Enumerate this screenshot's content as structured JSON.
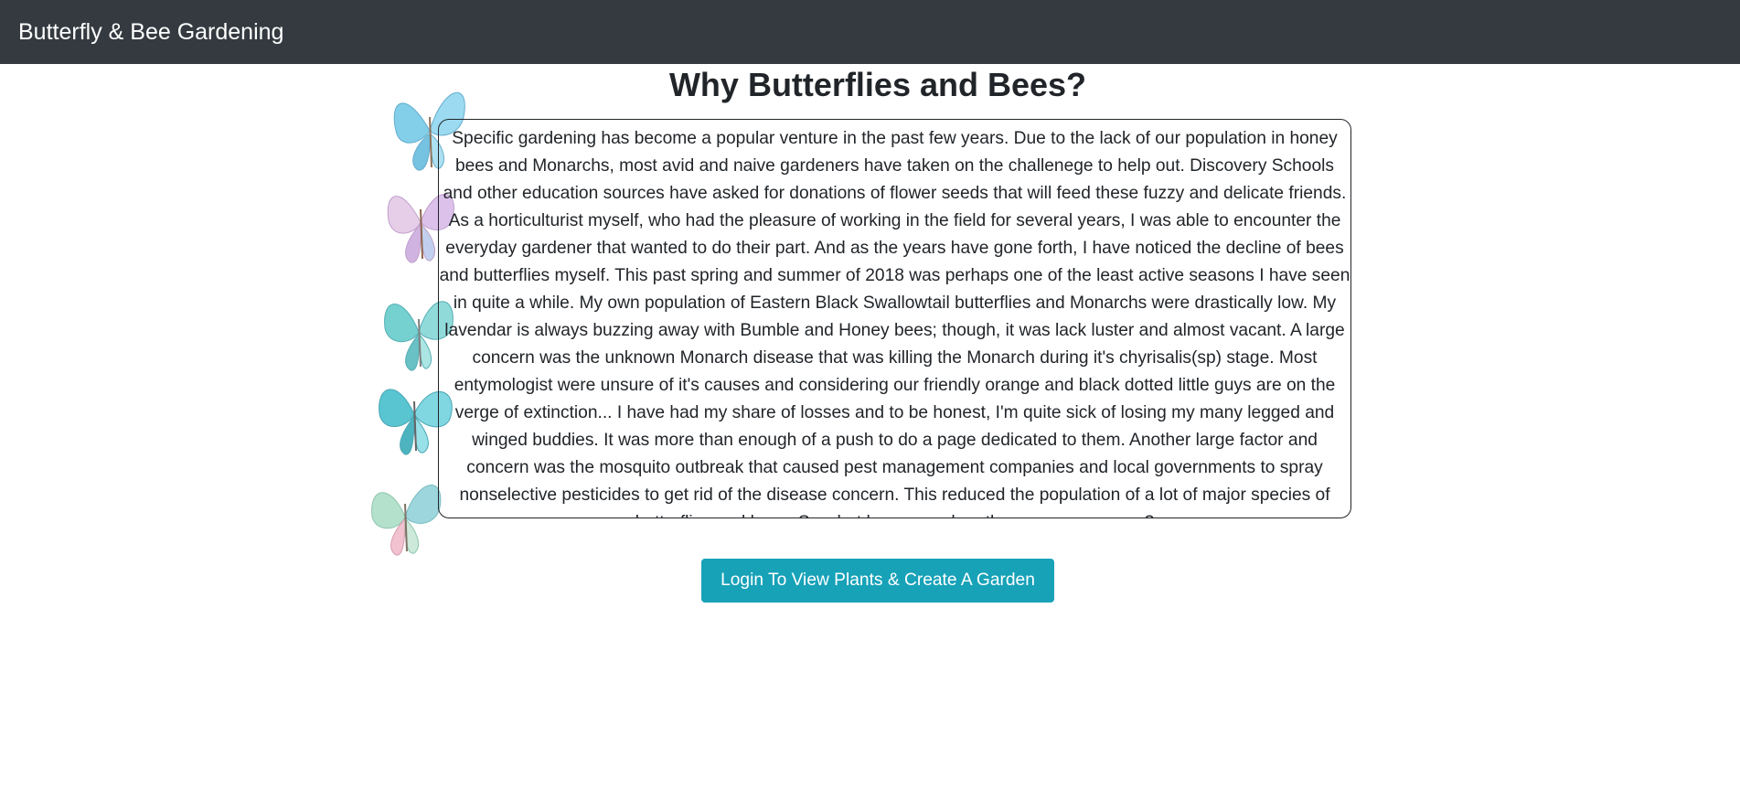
{
  "navbar": {
    "brand": "Butterfly & Bee Gardening"
  },
  "main": {
    "title": "Why Butterflies and Bees?",
    "body": "Specific gardening has become a popular venture in the past few years. Due to the lack of our population in honey bees and Monarchs, most avid and naive gardeners have taken on the challenege to help out. Discovery Schools and other education sources have asked for donations of flower seeds that will feed these fuzzy and delicate friends. As a horticulturist myself, who had the pleasure of working in the field for several years, I was able to encounter the everyday gardener that wanted to do their part. And as the years have gone forth, I have noticed the decline of bees and butterflies myself. This past spring and summer of 2018 was perhaps one of the least active seasons I have seen in quite a while. My own population of Eastern Black Swallowtail butterflies and Monarchs were drastically low. My lavendar is always buzzing away with Bumble and Honey bees; though, it was lack luster and almost vacant. A large concern was the unknown Monarch disease that was killing the Monarch during it's chyrisalis(sp) stage. Most entymologist were unsure of it's causes and considering our friendly orange and black dotted little guys are on the verge of extinction... I have had my share of losses and to be honest, I'm quite sick of losing my many legged and winged buddies. It was more than enough of a push to do a page dedicated to them. Another large factor and concern was the mosquito outbreak that caused pest management companies and local governments to spray nonselective pesticides to get rid of the disease concern. This reduced the population of a lot of major species of butterflies and bees. So what happens when these guys are gone?",
    "login_button": "Login To View Plants & Create A Garden"
  },
  "decorations": {
    "butterflies": [
      "butterfly-blue",
      "butterfly-pink",
      "butterfly-teal",
      "butterfly-turquoise",
      "butterfly-green"
    ],
    "colors": {
      "navbar_bg": "#343a40",
      "button_bg": "#17a2b8",
      "text": "#212529"
    }
  }
}
